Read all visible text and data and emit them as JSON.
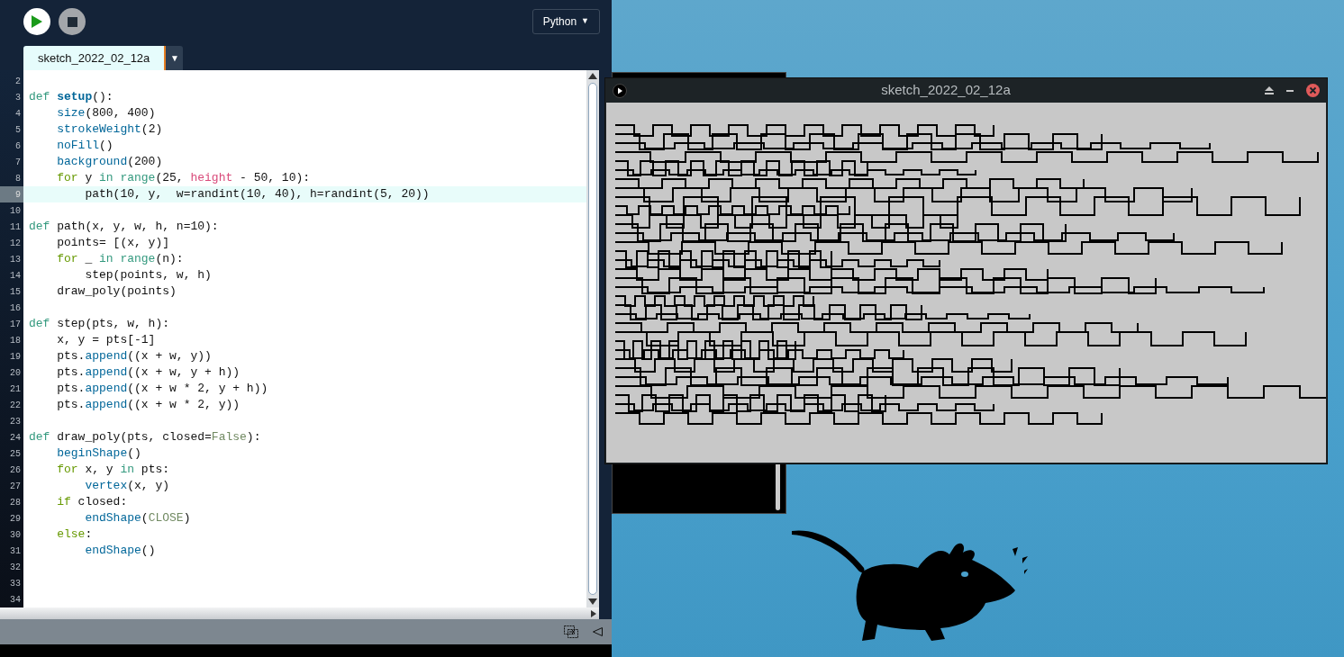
{
  "toolbar": {
    "run_button": {
      "enabled": true
    },
    "stop_button": {
      "enabled": false
    },
    "mode_selector": {
      "label": "Python",
      "arrow": "▼"
    }
  },
  "tabs": [
    {
      "label": "sketch_2022_02_12a",
      "selected": true
    }
  ],
  "tab_menu_arrow": "▼",
  "editor": {
    "lines": [
      {
        "number": "2",
        "selected": false
      },
      {
        "number": "3",
        "selected": false,
        "tokens": [
          {
            "text": "def ",
            "kind": "def"
          },
          {
            "text": "setup",
            "kind": "fnb"
          },
          {
            "text": "():",
            "kind": "p"
          }
        ]
      },
      {
        "number": "4",
        "selected": false,
        "tokens": [
          {
            "text": "    size",
            "kind": "fn"
          },
          {
            "text": "(800, 400)",
            "kind": "p"
          }
        ]
      },
      {
        "number": "5",
        "selected": false,
        "tokens": [
          {
            "text": "    strokeWeight",
            "kind": "fn"
          },
          {
            "text": "(2)",
            "kind": "p"
          }
        ]
      },
      {
        "number": "6",
        "selected": false,
        "tokens": [
          {
            "text": "    noFill",
            "kind": "fn"
          },
          {
            "text": "()",
            "kind": "p"
          }
        ]
      },
      {
        "number": "7",
        "selected": false,
        "tokens": [
          {
            "text": "    background",
            "kind": "fn"
          },
          {
            "text": "(200)",
            "kind": "p"
          }
        ]
      },
      {
        "number": "8",
        "selected": false,
        "tokens": [
          {
            "text": "    for",
            "kind": "flow"
          },
          {
            "text": " y ",
            "kind": "p"
          },
          {
            "text": "in range",
            "kind": "def"
          },
          {
            "text": "(25, ",
            "kind": "p"
          },
          {
            "text": "height",
            "kind": "var"
          },
          {
            "text": " - 50, 10):",
            "kind": "p"
          }
        ]
      },
      {
        "number": "9",
        "selected": true,
        "tokens": [
          {
            "text": "        path(10, y,  w=randint(10, 40), h=randint(5, 20))",
            "kind": "p"
          }
        ]
      },
      {
        "number": "10",
        "selected": false
      },
      {
        "number": "11",
        "selected": false,
        "tokens": [
          {
            "text": "def",
            "kind": "def"
          },
          {
            "text": " path(x, y, w, h, n=10):",
            "kind": "p"
          }
        ]
      },
      {
        "number": "12",
        "selected": false,
        "tokens": [
          {
            "text": "    points= [(x, y)]",
            "kind": "p"
          }
        ]
      },
      {
        "number": "13",
        "selected": false,
        "tokens": [
          {
            "text": "    for",
            "kind": "flow"
          },
          {
            "text": " _ ",
            "kind": "p"
          },
          {
            "text": "in range",
            "kind": "def"
          },
          {
            "text": "(n):",
            "kind": "p"
          }
        ]
      },
      {
        "number": "14",
        "selected": false,
        "tokens": [
          {
            "text": "        step(points, w, h)",
            "kind": "p"
          }
        ]
      },
      {
        "number": "15",
        "selected": false,
        "tokens": [
          {
            "text": "    draw_poly(points)",
            "kind": "p"
          }
        ]
      },
      {
        "number": "16",
        "selected": false
      },
      {
        "number": "17",
        "selected": false,
        "tokens": [
          {
            "text": "def",
            "kind": "def"
          },
          {
            "text": " step(pts, w, h):",
            "kind": "p"
          }
        ]
      },
      {
        "number": "18",
        "selected": false,
        "tokens": [
          {
            "text": "    x, y = pts[-1]",
            "kind": "p"
          }
        ]
      },
      {
        "number": "19",
        "selected": false,
        "tokens": [
          {
            "text": "    pts.",
            "kind": "p"
          },
          {
            "text": "append",
            "kind": "fn"
          },
          {
            "text": "((x + w, y))",
            "kind": "p"
          }
        ]
      },
      {
        "number": "20",
        "selected": false,
        "tokens": [
          {
            "text": "    pts.",
            "kind": "p"
          },
          {
            "text": "append",
            "kind": "fn"
          },
          {
            "text": "((x + w, y + h))",
            "kind": "p"
          }
        ]
      },
      {
        "number": "21",
        "selected": false,
        "tokens": [
          {
            "text": "    pts.",
            "kind": "p"
          },
          {
            "text": "append",
            "kind": "fn"
          },
          {
            "text": "((x + w * 2, y + h))",
            "kind": "p"
          }
        ]
      },
      {
        "number": "22",
        "selected": false,
        "tokens": [
          {
            "text": "    pts.",
            "kind": "p"
          },
          {
            "text": "append",
            "kind": "fn"
          },
          {
            "text": "((x + w * 2, y))",
            "kind": "p"
          }
        ]
      },
      {
        "number": "23",
        "selected": false
      },
      {
        "number": "24",
        "selected": false,
        "tokens": [
          {
            "text": "def",
            "kind": "def"
          },
          {
            "text": " draw_poly(pts, closed=",
            "kind": "p"
          },
          {
            "text": "False",
            "kind": "const"
          },
          {
            "text": "):",
            "kind": "p"
          }
        ]
      },
      {
        "number": "25",
        "selected": false,
        "tokens": [
          {
            "text": "    beginShape",
            "kind": "fn"
          },
          {
            "text": "()",
            "kind": "p"
          }
        ]
      },
      {
        "number": "26",
        "selected": false,
        "tokens": [
          {
            "text": "    for",
            "kind": "flow"
          },
          {
            "text": " x, y ",
            "kind": "p"
          },
          {
            "text": "in",
            "kind": "def"
          },
          {
            "text": " pts:",
            "kind": "p"
          }
        ]
      },
      {
        "number": "27",
        "selected": false,
        "tokens": [
          {
            "text": "        vertex",
            "kind": "fn"
          },
          {
            "text": "(x, y)",
            "kind": "p"
          }
        ]
      },
      {
        "number": "28",
        "selected": false,
        "tokens": [
          {
            "text": "    if",
            "kind": "flow"
          },
          {
            "text": " closed:",
            "kind": "p"
          }
        ]
      },
      {
        "number": "29",
        "selected": false,
        "tokens": [
          {
            "text": "        endShape",
            "kind": "fn"
          },
          {
            "text": "(",
            "kind": "p"
          },
          {
            "text": "CLOSE",
            "kind": "const"
          },
          {
            "text": ")",
            "kind": "p"
          }
        ]
      },
      {
        "number": "30",
        "selected": false,
        "tokens": [
          {
            "text": "    else",
            "kind": "flow"
          },
          {
            "text": ":",
            "kind": "p"
          }
        ]
      },
      {
        "number": "31",
        "selected": false,
        "tokens": [
          {
            "text": "        endShape",
            "kind": "fn"
          },
          {
            "text": "()",
            "kind": "p"
          }
        ]
      },
      {
        "number": "32",
        "selected": false
      },
      {
        "number": "33",
        "selected": false
      },
      {
        "number": "34",
        "selected": false
      }
    ]
  },
  "sketch_window": {
    "title": "sketch_2022_02_12a"
  }
}
